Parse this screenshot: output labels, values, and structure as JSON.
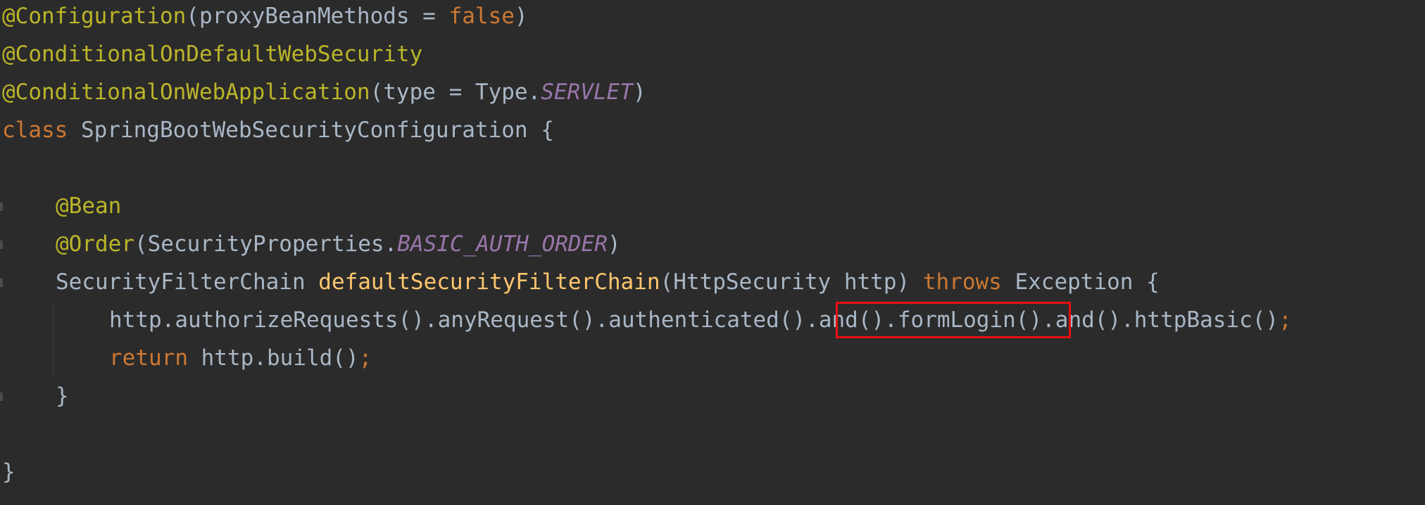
{
  "editor": {
    "lines": {
      "l1": {
        "annotation": "@Configuration",
        "open": "(",
        "param": "proxyBeanMethods = ",
        "value": "false",
        "close": ")"
      },
      "l2": {
        "annotation": "@ConditionalOnDefaultWebSecurity"
      },
      "l3": {
        "annotation": "@ConditionalOnWebApplication",
        "open": "(type = Type.",
        "constant": "SERVLET",
        "close": ")"
      },
      "l4": {
        "keyword": "class",
        "rest": " SpringBootWebSecurityConfiguration {"
      },
      "l6": {
        "annotation": "@Bean"
      },
      "l7": {
        "annotation": "@Order",
        "open": "(SecurityProperties.",
        "constant": "BASIC_AUTH_ORDER",
        "close": ")"
      },
      "l8": {
        "type": "SecurityFilterChain ",
        "method": "defaultSecurityFilterChain",
        "params": "(HttpSecurity http) ",
        "keyword": "throws",
        "rest": " Exception {"
      },
      "l9": {
        "before": "http.authorizeRequests().anyRequest().authenticated().",
        "highlighted": "and().formLogin()",
        "after": ".and().httpBasic()",
        "semicolon": ";"
      },
      "l10": {
        "keyword": "return",
        "rest": " http.build()",
        "semicolon": ";"
      },
      "l11": {
        "text": "}"
      },
      "l13": {
        "text": "}"
      }
    }
  }
}
